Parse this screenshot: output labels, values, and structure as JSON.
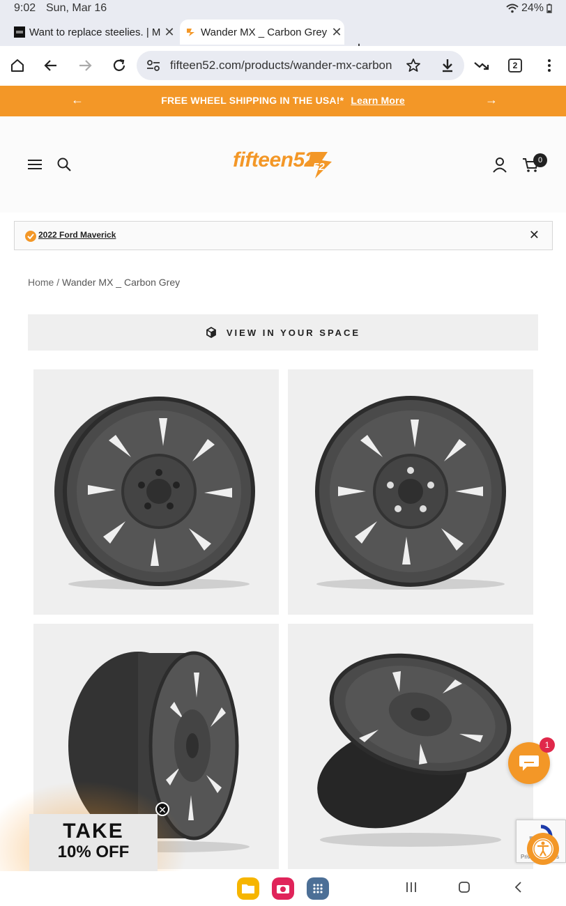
{
  "status_bar": {
    "time": "9:02",
    "date": "Sun, Mar 16",
    "battery": "24%"
  },
  "tabs": [
    {
      "title": "Want to replace steelies. | M",
      "icon": "site-favicon",
      "active": false
    },
    {
      "title": "Wander MX _ Carbon Grey",
      "icon": "fifteen52-favicon",
      "active": true
    }
  ],
  "browser": {
    "url": "fifteen52.com/products/wander-mx-carbon",
    "tab_count": "2"
  },
  "banner": {
    "text": "FREE WHEEL SHIPPING IN THE USA!*",
    "link": "Learn More",
    "color": "#f39727"
  },
  "header": {
    "logo": "fifteen52",
    "cart_count": "0"
  },
  "vehicle": {
    "label": "2022 Ford Maverick"
  },
  "breadcrumb": {
    "home": "Home",
    "separator": "/",
    "current": "Wander MX _ Carbon Grey"
  },
  "view_in_space": {
    "label": "VIEW IN YOUR SPACE"
  },
  "gallery": {
    "images": [
      "wheel-angle-view",
      "wheel-front-view",
      "wheel-side-view",
      "wheel-tilted-view"
    ]
  },
  "promo": {
    "line1": "TAKE",
    "line2": "10% OFF"
  },
  "chat": {
    "badge": "1"
  },
  "recaptcha": {
    "text": "Privacy - Terms"
  }
}
